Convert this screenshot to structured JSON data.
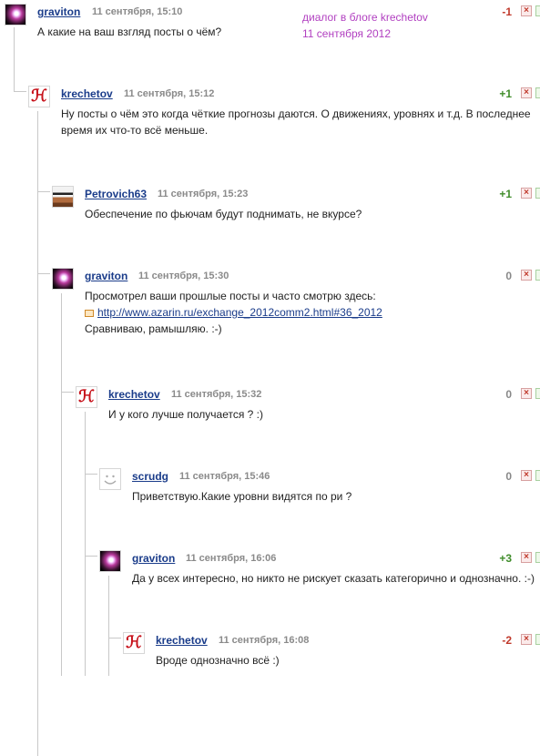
{
  "note": {
    "line1": "диалог в блоге krechetov",
    "line2": "11 сентября 2012"
  },
  "comments": [
    {
      "author": "graviton",
      "date": "11 сентября, 15:10",
      "rating": "-1",
      "lines": [
        "А какие на ваш взгляд посты о чём?"
      ]
    },
    {
      "author": "krechetov",
      "date": "11 сентября, 15:12",
      "rating": "+1",
      "lines": [
        "Ну посты о чём это когда чёткие прогнозы даются. О движениях, уровнях и т.д. В последнее",
        "время их что-то всё меньше."
      ]
    },
    {
      "author": "Petrovich63",
      "date": "11 сентября, 15:23",
      "rating": "+1",
      "lines": [
        "Обеспечение по фьючам будут поднимать, не вкурсе?"
      ]
    },
    {
      "author": "graviton",
      "date": "11 сентября, 15:30",
      "rating": "0",
      "lines": [
        "Просмотрел ваши прошлые посты и часто смотрю здесь:"
      ],
      "link": "http://www.azarin.ru/exchange_2012comm2.html#36_2012",
      "after": "Сравниваю, рамышляю. :-)"
    },
    {
      "author": "krechetov",
      "date": "11 сентября, 15:32",
      "rating": "0",
      "lines": [
        "И у кого лучше получается ? :)"
      ]
    },
    {
      "author": "scrudg",
      "date": "11 сентября, 15:46",
      "rating": "0",
      "lines": [
        "Приветствую.Какие уровни видятся по ри ?"
      ]
    },
    {
      "author": "graviton",
      "date": "11 сентября, 16:06",
      "rating": "+3",
      "lines": [
        "Да у всех интересно, но никто не рискует сказать категорично и однозначно. :-)"
      ]
    },
    {
      "author": "krechetov",
      "date": "11 сентября, 16:08",
      "rating": "-2",
      "lines": [
        "Вроде однозначно всё :)"
      ]
    }
  ],
  "icons": {
    "delete": "close-icon",
    "approve": "check-icon",
    "link": "external-link-icon"
  },
  "colors": {
    "author_link": "#1a3c8a",
    "rating_positive": "#3f8c2a",
    "rating_negative": "#c0392b",
    "note": "#b13fc0"
  }
}
